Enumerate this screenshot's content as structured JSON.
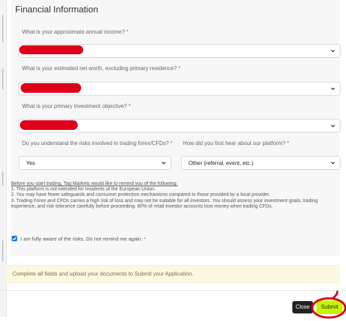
{
  "section": {
    "title": "Financial Information"
  },
  "questions": [
    {
      "label": "What is your approximate annual income?",
      "required": "*",
      "selected": ""
    },
    {
      "label": "What is your estimated net worth, excluding primary residence?",
      "required": "*",
      "selected": ""
    },
    {
      "label": "What is your primary investment objective?",
      "required": "*",
      "selected": ""
    },
    {
      "label": "Do you understand the risks involved in trading forex/CFDs?",
      "required": "*",
      "selected": "Yes"
    },
    {
      "label": "How did you first hear about our platform?",
      "required": "*",
      "selected": "Other (referral, event, etc.)"
    }
  ],
  "notice": {
    "heading": "Before you start trading, Tag Markets would like to remind you of the following:",
    "line1": "1. This platform is not intended for residents of the European Union.",
    "line2": "2. You may have fewer safeguards and consumer protection mechanisms compared to those provided by a local provider.",
    "line3": "3. Trading Forex and CFDs carries a high risk of loss and may not be suitable for all investors. You should assess your investment goals, trading experience, and risk tolerance carefully before proceeding. 80% of retail investor accounts lose money when trading CFDs."
  },
  "acknowledge": {
    "label": "I am fully aware of the risks. Do not remind me again.",
    "required": "*",
    "checked": true
  },
  "alert": {
    "text": "Complete all fields and upload your documents to Submit your Application."
  },
  "buttons": {
    "close": "Close",
    "submit": "Submit"
  },
  "colors": {
    "accent": "#c5f500",
    "redaction": "#e0001a",
    "alert_bg": "#fcf8e3",
    "alert_text": "#8a6d3b",
    "checkbox": "#1a73e8",
    "annotation": "#d9001b"
  }
}
